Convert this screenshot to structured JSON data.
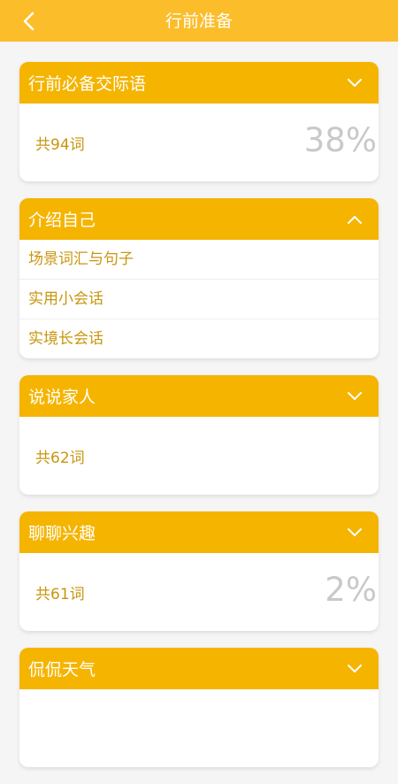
{
  "header": {
    "title": "行前准备"
  },
  "cards": [
    {
      "title": "行前必备交际语",
      "count": "共94词",
      "percent": "38%"
    },
    {
      "title": "介绍自己",
      "items": [
        "场景词汇与句子",
        "实用小会话",
        "实境长会话"
      ]
    },
    {
      "title": "说说家人",
      "count": "共62词",
      "percent": ""
    },
    {
      "title": "聊聊兴趣",
      "count": "共61词",
      "percent": "2%"
    },
    {
      "title": "侃侃天气"
    }
  ],
  "colors": {
    "topbar": "#fcbd2a",
    "card_header": "#f5b400",
    "accent_text": "#c8960f",
    "percent_text": "#c9c9c9"
  }
}
